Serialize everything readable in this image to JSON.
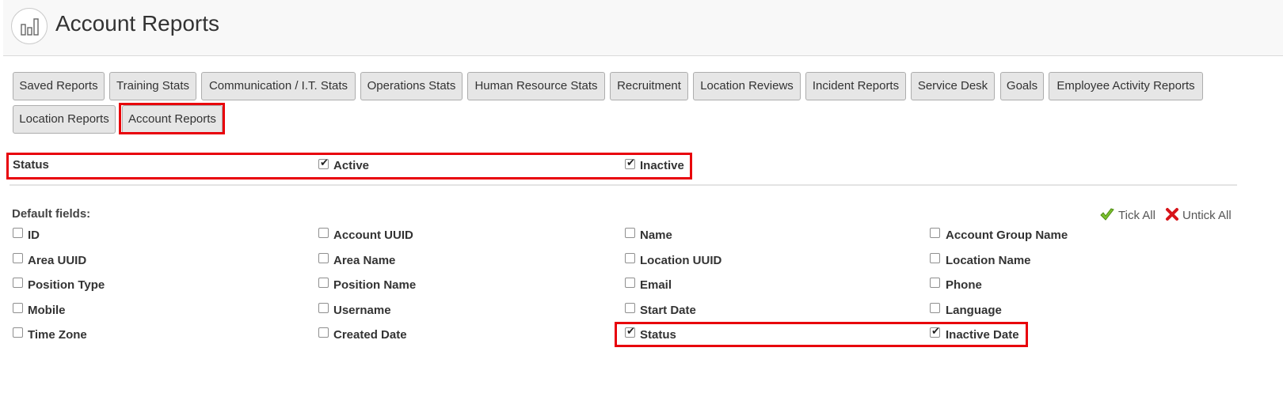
{
  "header": {
    "title": "Account Reports",
    "logo_icon": "bar-chart-icon"
  },
  "tabs": [
    {
      "label": "Saved Reports"
    },
    {
      "label": "Training Stats"
    },
    {
      "label": "Communication / I.T. Stats"
    },
    {
      "label": "Operations Stats"
    },
    {
      "label": "Human Resource Stats"
    },
    {
      "label": "Recruitment"
    },
    {
      "label": "Location Reviews"
    },
    {
      "label": "Incident Reports"
    },
    {
      "label": "Service Desk"
    },
    {
      "label": "Goals"
    },
    {
      "label": "Employee Activity Reports"
    },
    {
      "label": "Location Reports"
    },
    {
      "label": "Account Reports",
      "active": true
    }
  ],
  "status_filter": {
    "label": "Status",
    "options": [
      {
        "label": "Active",
        "checked": true
      },
      {
        "label": "Inactive",
        "checked": true
      }
    ]
  },
  "default_fields": {
    "label": "Default fields:",
    "tick_all": "Tick All",
    "untick_all": "Untick All",
    "fields": [
      {
        "label": "ID",
        "checked": false
      },
      {
        "label": "Account UUID",
        "checked": false
      },
      {
        "label": "Name",
        "checked": false
      },
      {
        "label": "Account Group Name",
        "checked": false
      },
      {
        "label": "Area UUID",
        "checked": false
      },
      {
        "label": "Area Name",
        "checked": false
      },
      {
        "label": "Location UUID",
        "checked": false
      },
      {
        "label": "Location Name",
        "checked": false
      },
      {
        "label": "Position Type",
        "checked": false
      },
      {
        "label": "Position Name",
        "checked": false
      },
      {
        "label": "Email",
        "checked": false
      },
      {
        "label": "Phone",
        "checked": false
      },
      {
        "label": "Mobile",
        "checked": false
      },
      {
        "label": "Username",
        "checked": false
      },
      {
        "label": "Start Date",
        "checked": false
      },
      {
        "label": "Language",
        "checked": false
      },
      {
        "label": "Time Zone",
        "checked": false
      },
      {
        "label": "Created Date",
        "checked": false
      },
      {
        "label": "Status",
        "checked": true
      },
      {
        "label": "Inactive Date",
        "checked": true
      }
    ]
  },
  "colors": {
    "highlight": "#e8000b",
    "tick": "#7cc22f",
    "untick": "#d7141a"
  }
}
